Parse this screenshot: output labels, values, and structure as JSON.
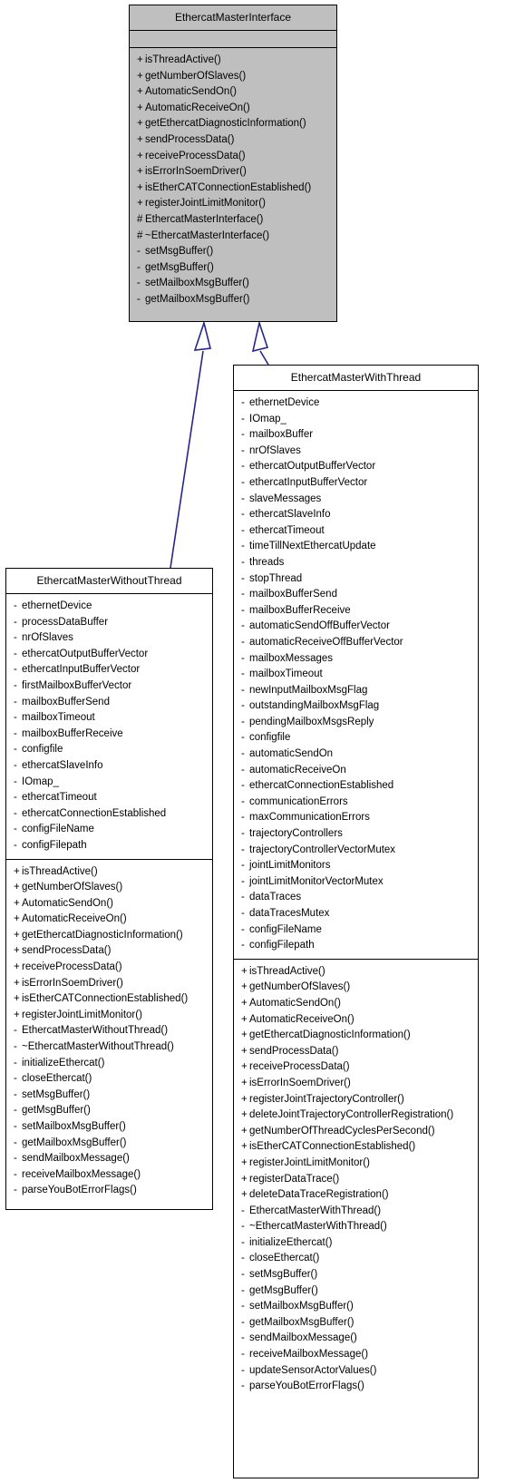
{
  "diagram": {
    "kind": "uml-class-inheritance-diagram",
    "edge_color": "#26268c",
    "base_fill": "#bfbfbf",
    "derived_fill": "#ffffff",
    "border_color": "#000000",
    "relations": [
      {
        "name": "inheritance-without-thread",
        "from": "EthercatMasterWithoutThread",
        "to": "EthercatMasterInterface",
        "arrow": "hollow-triangle"
      },
      {
        "name": "inheritance-with-thread",
        "from": "EthercatMasterWithThread",
        "to": "EthercatMasterInterface",
        "arrow": "hollow-triangle"
      }
    ]
  },
  "classes": [
    {
      "id": "interface",
      "name": "EthercatMasterInterface",
      "attributes": [],
      "methods": [
        {
          "vis": "+",
          "label": "isThreadActive()"
        },
        {
          "vis": "+",
          "label": "getNumberOfSlaves()"
        },
        {
          "vis": "+",
          "label": "AutomaticSendOn()"
        },
        {
          "vis": "+",
          "label": "AutomaticReceiveOn()"
        },
        {
          "vis": "+",
          "label": "getEthercatDiagnosticInformation()"
        },
        {
          "vis": "+",
          "label": "sendProcessData()"
        },
        {
          "vis": "+",
          "label": "receiveProcessData()"
        },
        {
          "vis": "+",
          "label": "isErrorInSoemDriver()"
        },
        {
          "vis": "+",
          "label": "isEtherCATConnectionEstablished()"
        },
        {
          "vis": "+",
          "label": "registerJointLimitMonitor()"
        },
        {
          "vis": "#",
          "label": "EthercatMasterInterface()"
        },
        {
          "vis": "#",
          "label": "~EthercatMasterInterface()"
        },
        {
          "vis": "-",
          "label": "setMsgBuffer()"
        },
        {
          "vis": "-",
          "label": "getMsgBuffer()"
        },
        {
          "vis": "-",
          "label": "setMailboxMsgBuffer()"
        },
        {
          "vis": "-",
          "label": "getMailboxMsgBuffer()"
        }
      ]
    },
    {
      "id": "without",
      "name": "EthercatMasterWithoutThread",
      "attributes": [
        {
          "vis": "-",
          "label": "ethernetDevice"
        },
        {
          "vis": "-",
          "label": "processDataBuffer"
        },
        {
          "vis": "-",
          "label": "nrOfSlaves"
        },
        {
          "vis": "-",
          "label": "ethercatOutputBufferVector"
        },
        {
          "vis": "-",
          "label": "ethercatInputBufferVector"
        },
        {
          "vis": "-",
          "label": "firstMailboxBufferVector"
        },
        {
          "vis": "-",
          "label": "mailboxBufferSend"
        },
        {
          "vis": "-",
          "label": "mailboxTimeout"
        },
        {
          "vis": "-",
          "label": "mailboxBufferReceive"
        },
        {
          "vis": "-",
          "label": "configfile"
        },
        {
          "vis": "-",
          "label": "ethercatSlaveInfo"
        },
        {
          "vis": "-",
          "label": "IOmap_"
        },
        {
          "vis": "-",
          "label": "ethercatTimeout"
        },
        {
          "vis": "-",
          "label": "ethercatConnectionEstablished"
        },
        {
          "vis": "-",
          "label": "configFileName"
        },
        {
          "vis": "-",
          "label": "configFilepath"
        }
      ],
      "methods": [
        {
          "vis": "+",
          "label": "isThreadActive()"
        },
        {
          "vis": "+",
          "label": "getNumberOfSlaves()"
        },
        {
          "vis": "+",
          "label": "AutomaticSendOn()"
        },
        {
          "vis": "+",
          "label": "AutomaticReceiveOn()"
        },
        {
          "vis": "+",
          "label": "getEthercatDiagnosticInformation()"
        },
        {
          "vis": "+",
          "label": "sendProcessData()"
        },
        {
          "vis": "+",
          "label": "receiveProcessData()"
        },
        {
          "vis": "+",
          "label": "isErrorInSoemDriver()"
        },
        {
          "vis": "+",
          "label": "isEtherCATConnectionEstablished()"
        },
        {
          "vis": "+",
          "label": "registerJointLimitMonitor()"
        },
        {
          "vis": "-",
          "label": "EthercatMasterWithoutThread()"
        },
        {
          "vis": "-",
          "label": "~EthercatMasterWithoutThread()"
        },
        {
          "vis": "-",
          "label": "initializeEthercat()"
        },
        {
          "vis": "-",
          "label": "closeEthercat()"
        },
        {
          "vis": "-",
          "label": "setMsgBuffer()"
        },
        {
          "vis": "-",
          "label": "getMsgBuffer()"
        },
        {
          "vis": "-",
          "label": "setMailboxMsgBuffer()"
        },
        {
          "vis": "-",
          "label": "getMailboxMsgBuffer()"
        },
        {
          "vis": "-",
          "label": "sendMailboxMessage()"
        },
        {
          "vis": "-",
          "label": "receiveMailboxMessage()"
        },
        {
          "vis": "-",
          "label": "parseYouBotErrorFlags()"
        }
      ]
    },
    {
      "id": "with",
      "name": "EthercatMasterWithThread",
      "attributes": [
        {
          "vis": "-",
          "label": "ethernetDevice"
        },
        {
          "vis": "-",
          "label": "IOmap_"
        },
        {
          "vis": "-",
          "label": "mailboxBuffer"
        },
        {
          "vis": "-",
          "label": "nrOfSlaves"
        },
        {
          "vis": "-",
          "label": "ethercatOutputBufferVector"
        },
        {
          "vis": "-",
          "label": "ethercatInputBufferVector"
        },
        {
          "vis": "-",
          "label": "slaveMessages"
        },
        {
          "vis": "-",
          "label": "ethercatSlaveInfo"
        },
        {
          "vis": "-",
          "label": "ethercatTimeout"
        },
        {
          "vis": "-",
          "label": "timeTillNextEthercatUpdate"
        },
        {
          "vis": "-",
          "label": "threads"
        },
        {
          "vis": "-",
          "label": "stopThread"
        },
        {
          "vis": "-",
          "label": "mailboxBufferSend"
        },
        {
          "vis": "-",
          "label": "mailboxBufferReceive"
        },
        {
          "vis": "-",
          "label": "automaticSendOffBufferVector"
        },
        {
          "vis": "-",
          "label": "automaticReceiveOffBufferVector"
        },
        {
          "vis": "-",
          "label": "mailboxMessages"
        },
        {
          "vis": "-",
          "label": "mailboxTimeout"
        },
        {
          "vis": "-",
          "label": "newInputMailboxMsgFlag"
        },
        {
          "vis": "-",
          "label": "outstandingMailboxMsgFlag"
        },
        {
          "vis": "-",
          "label": "pendingMailboxMsgsReply"
        },
        {
          "vis": "-",
          "label": "configfile"
        },
        {
          "vis": "-",
          "label": "automaticSendOn"
        },
        {
          "vis": "-",
          "label": "automaticReceiveOn"
        },
        {
          "vis": "-",
          "label": "ethercatConnectionEstablished"
        },
        {
          "vis": "-",
          "label": "communicationErrors"
        },
        {
          "vis": "-",
          "label": "maxCommunicationErrors"
        },
        {
          "vis": "-",
          "label": "trajectoryControllers"
        },
        {
          "vis": "-",
          "label": "trajectoryControllerVectorMutex"
        },
        {
          "vis": "-",
          "label": "jointLimitMonitors"
        },
        {
          "vis": "-",
          "label": "jointLimitMonitorVectorMutex"
        },
        {
          "vis": "-",
          "label": "dataTraces"
        },
        {
          "vis": "-",
          "label": "dataTracesMutex"
        },
        {
          "vis": "-",
          "label": "configFileName"
        },
        {
          "vis": "-",
          "label": "configFilepath"
        }
      ],
      "methods": [
        {
          "vis": "+",
          "label": "isThreadActive()"
        },
        {
          "vis": "+",
          "label": "getNumberOfSlaves()"
        },
        {
          "vis": "+",
          "label": "AutomaticSendOn()"
        },
        {
          "vis": "+",
          "label": "AutomaticReceiveOn()"
        },
        {
          "vis": "+",
          "label": "getEthercatDiagnosticInformation()"
        },
        {
          "vis": "+",
          "label": "sendProcessData()"
        },
        {
          "vis": "+",
          "label": "receiveProcessData()"
        },
        {
          "vis": "+",
          "label": "isErrorInSoemDriver()"
        },
        {
          "vis": "+",
          "label": "registerJointTrajectoryController()"
        },
        {
          "vis": "+",
          "label": "deleteJointTrajectoryControllerRegistration()"
        },
        {
          "vis": "+",
          "label": "getNumberOfThreadCyclesPerSecond()"
        },
        {
          "vis": "+",
          "label": "isEtherCATConnectionEstablished()"
        },
        {
          "vis": "+",
          "label": "registerJointLimitMonitor()"
        },
        {
          "vis": "+",
          "label": "registerDataTrace()"
        },
        {
          "vis": "+",
          "label": "deleteDataTraceRegistration()"
        },
        {
          "vis": "-",
          "label": "EthercatMasterWithThread()"
        },
        {
          "vis": "-",
          "label": "~EthercatMasterWithThread()"
        },
        {
          "vis": "-",
          "label": "initializeEthercat()"
        },
        {
          "vis": "-",
          "label": "closeEthercat()"
        },
        {
          "vis": "-",
          "label": "setMsgBuffer()"
        },
        {
          "vis": "-",
          "label": "getMsgBuffer()"
        },
        {
          "vis": "-",
          "label": "setMailboxMsgBuffer()"
        },
        {
          "vis": "-",
          "label": "getMailboxMsgBuffer()"
        },
        {
          "vis": "-",
          "label": "sendMailboxMessage()"
        },
        {
          "vis": "-",
          "label": "receiveMailboxMessage()"
        },
        {
          "vis": "-",
          "label": "updateSensorActorValues()"
        },
        {
          "vis": "-",
          "label": "parseYouBotErrorFlags()"
        }
      ]
    }
  ]
}
